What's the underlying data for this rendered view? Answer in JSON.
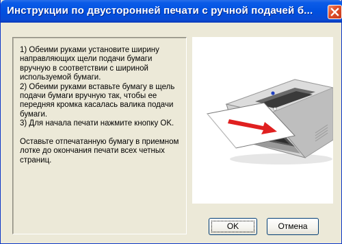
{
  "window": {
    "title": "Инструкции по двусторонней печати с ручной подачей б...",
    "close_icon": "close-icon"
  },
  "instructions": {
    "paragraphs": [
      "1) Обеими руками установите ширину направляющих щели подачи бумаги вручную в соответствии с шириной используемой бумаги.",
      "2) Обеими руками вставьте бумагу в щель подачи бумаги вручную так, чтобы ее передняя кромка касалась валика подачи бумаги.",
      "3) Для начала печати нажмите кнопку OK.",
      "Оставьте отпечатанную бумагу в приемном лотке до окончания печати всех четных страниц."
    ]
  },
  "illustration": {
    "subject": "printer-manual-feed-illustration",
    "colors": {
      "printer_body": "#c8c8c8",
      "printer_dark": "#505050",
      "arrow": "#e02020",
      "led": "#2040c0"
    }
  },
  "buttons": {
    "ok_label": "OK",
    "cancel_label": "Отмена"
  }
}
